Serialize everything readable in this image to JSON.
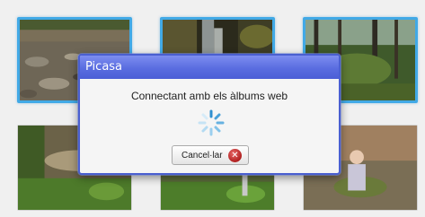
{
  "dialog": {
    "title": "Picasa",
    "message": "Connectant amb els àlbums web",
    "cancel_label": "Cancel·lar",
    "cancel_icon": "cancel-x-icon",
    "spinner_icon": "loading-spinner-icon"
  },
  "thumbnails": [
    {
      "subject": "rocky forest path",
      "selected": true
    },
    {
      "subject": "waterfall in forest",
      "selected": true
    },
    {
      "subject": "green forest trees",
      "selected": true
    },
    {
      "subject": "forest trail with ferns",
      "selected": false
    },
    {
      "subject": "forest floor with shrubs",
      "selected": false
    },
    {
      "subject": "child on forest path",
      "selected": false
    }
  ],
  "colors": {
    "selection_border": "#41a9e6",
    "dialog_titlebar": "#5a6de0",
    "dialog_border": "#4a5fd0",
    "cancel_icon": "#c0392b"
  }
}
